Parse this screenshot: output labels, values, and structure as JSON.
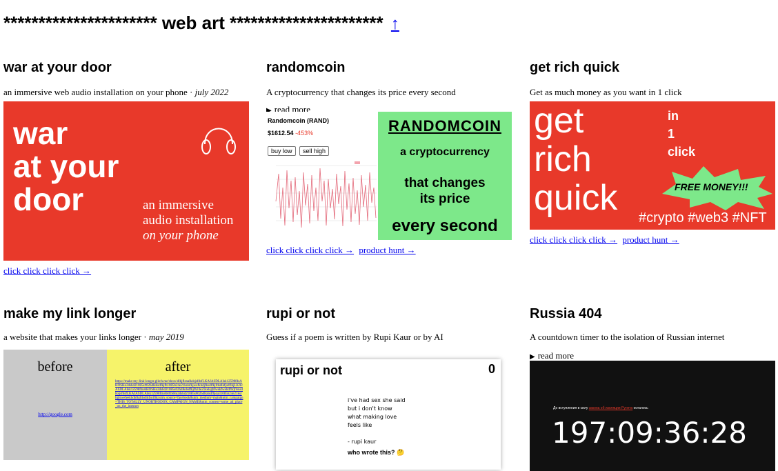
{
  "header": {
    "title": "********************** web art **********************",
    "up_link": "↑"
  },
  "projects": [
    {
      "title": "war at your door",
      "description": "an immersive web audio installation on your phone · ",
      "date": "july 2022",
      "image": {
        "big": [
          "war",
          "at your",
          "door"
        ],
        "small": [
          "an immersive",
          "audio installation"
        ],
        "small_italic": "on your phone",
        "bg": "#e8392a"
      },
      "links": [
        "click click click click →"
      ]
    },
    {
      "title": "randomcoin",
      "description": "A cryptocurrency that changes its price every second",
      "read_more": "read more",
      "image": {
        "coin_name": "Randomcoin (RAND)",
        "price": "$1612.54",
        "change": "-453%",
        "buy": "buy low",
        "sell": "sell high",
        "right": [
          "RANDOMCOIN",
          "a cryptocurrency",
          "that changes",
          "its price",
          "every second"
        ],
        "bg": "#7de88a"
      },
      "links": [
        "click click click click →",
        "product hunt →"
      ]
    },
    {
      "title": "get rich quick",
      "description": "Get as much money as you want in 1 click",
      "image": {
        "big": [
          "get",
          "rich",
          "quick"
        ],
        "side": [
          "in",
          "1",
          "click"
        ],
        "burst": "FREE MONEY!!!",
        "tags": "#crypto #web3 #NFT",
        "bg": "#e8392a"
      },
      "links": [
        "click click click click →",
        "product hunt →"
      ]
    },
    {
      "title": "make my link longer",
      "description": "a website that makes your links longer · ",
      "date": "may 2019",
      "image": {
        "before": "before",
        "after": "after",
        "short_url": "http://google.com",
        "long_url": "https://make-my-link-longer.glitch.me/show/dlkjflsnalkdsjsfdsfLKAJASDLAIsk12598fdsAHOSHo2dshd21085s#02hdlkdsdfkjfh1085b24e21kslsfkjwefkhdjfksdlfkjfdsdlkfjsdflkjLKAJASDLAIsk12598fdsAHOSHo2dshd21085s02hdlkdsdfkjfh24e21kelsgbfwekfwebdfbrjflsnsdlksjsfdsfLKAJASDLAIsk12598fdsAHOSHo2dshd21085s#02hdlkdsdfhjoa31085b24e21ksrbglswefeekhdbfkjfdsdlkfjsdflkj utm_source=facebook&utm_medium=main&utm_campaign=THIS_TOTALLY_UNORTHODOX_CAMPAIGN_NAME&utm_content=some_ad_place_on_the_internet"
      }
    },
    {
      "title": "rupi or not",
      "description": "Guess if a poem is written by Rupi Kaur or by AI",
      "image": {
        "heading": "rupi or not",
        "score": "0",
        "poem": "i've had sex she said\nbut i don't know\nwhat making love\nfeels like\n\n- rupi kaur",
        "question": "who wrote this? 🤔"
      }
    },
    {
      "title": "Russia 404",
      "description": "A countdown timer to the isolation of Russian internet",
      "read_more": "read more",
      "image": {
        "small_text": "До вступления в силу ",
        "small_link": "закона об изоляции Рунета",
        "small_end": " осталось",
        "timer": "197:09:36:28",
        "bg": "#111111"
      }
    }
  ]
}
